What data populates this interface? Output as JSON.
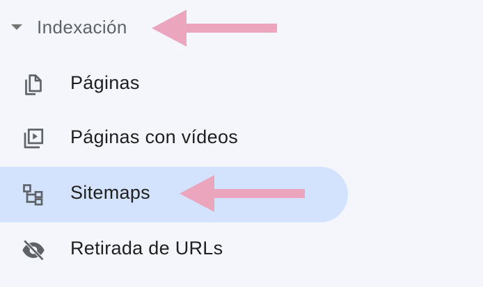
{
  "section": {
    "label": "Indexación",
    "caret_icon": "caret-down-icon"
  },
  "items": [
    {
      "label": "Páginas",
      "icon": "pages-icon",
      "active": false
    },
    {
      "label": "Páginas con vídeos",
      "icon": "video-pages-icon",
      "active": false
    },
    {
      "label": "Sitemaps",
      "icon": "sitemap-icon",
      "active": true
    },
    {
      "label": "Retirada de URLs",
      "icon": "eye-off-icon",
      "active": false
    }
  ],
  "colors": {
    "background": "#f4f6fb",
    "active_background": "#d3e3fd",
    "icon": "#5f6368",
    "text": "#1f1f1f",
    "section_text": "#5f6368",
    "annotation_arrow": "#eba6bd"
  }
}
